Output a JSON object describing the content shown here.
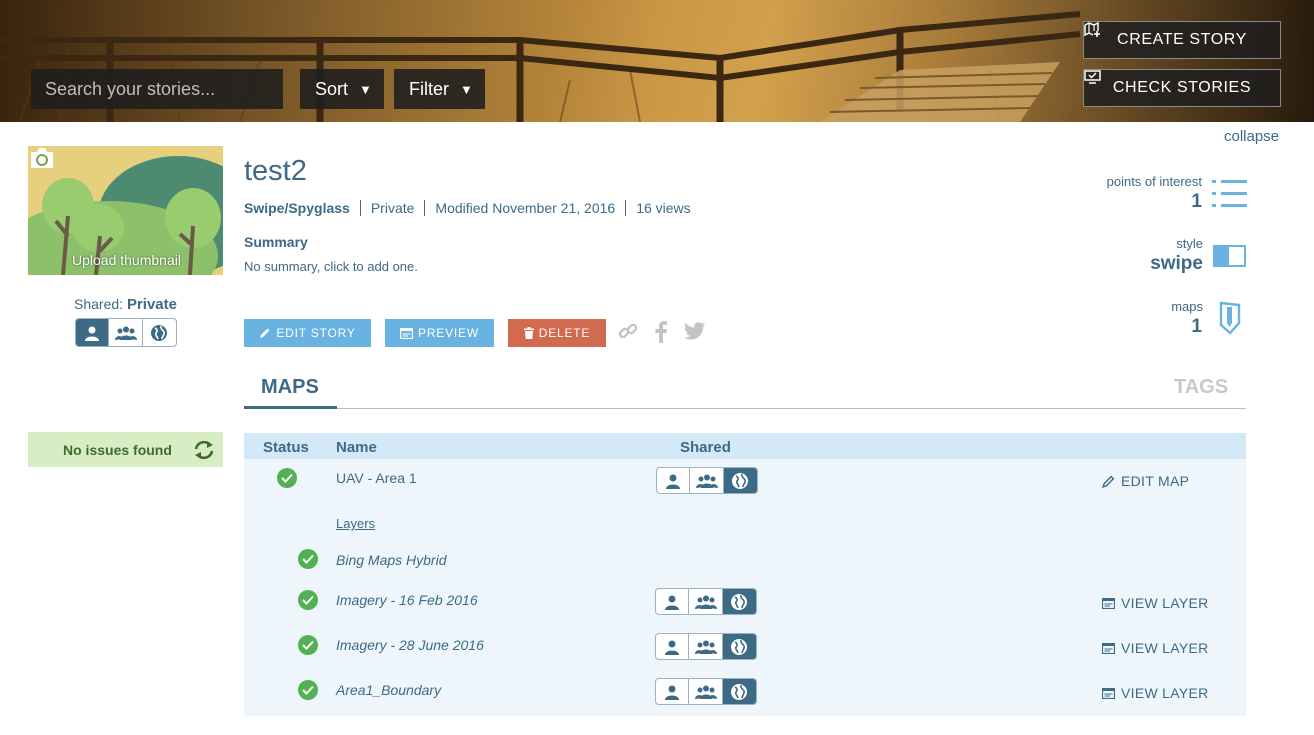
{
  "header": {
    "search_placeholder": "Search your stories...",
    "sort_label": "Sort",
    "filter_label": "Filter",
    "create_story_label": "CREATE STORY",
    "check_stories_label": "CHECK STORIES"
  },
  "collapse_label": "collapse",
  "thumbnail": {
    "caption": "Upload thumbnail"
  },
  "shared": {
    "label": "Shared:",
    "value": "Private"
  },
  "issues": {
    "label": "No issues found"
  },
  "story": {
    "title": "test2",
    "template": "Swipe/Spyglass",
    "privacy": "Private",
    "modified": "Modified November 21, 2016",
    "views": "16 views",
    "summary_heading": "Summary",
    "summary_text": "No summary, click to add one."
  },
  "actions": {
    "edit_label": "EDIT STORY",
    "preview_label": "PREVIEW",
    "delete_label": "DELETE"
  },
  "stats": {
    "poi_label": "points of interest",
    "poi_value": "1",
    "style_label": "style",
    "style_value": "swipe",
    "maps_label": "maps",
    "maps_value": "1"
  },
  "tabs": {
    "maps": "MAPS",
    "tags": "TAGS"
  },
  "table": {
    "col_status": "Status",
    "col_name": "Name",
    "col_shared": "Shared",
    "map": {
      "name": "UAV - Area 1",
      "action": "EDIT MAP"
    },
    "layers_label": "Layers",
    "layers": [
      {
        "name": "Bing Maps Hybrid"
      },
      {
        "name": "Imagery - 16 Feb 2016",
        "action": "VIEW LAYER"
      },
      {
        "name": "Imagery - 28 June 2016",
        "action": "VIEW LAYER"
      },
      {
        "name": "Area1_Boundary",
        "action": "VIEW LAYER"
      }
    ]
  },
  "colors": {
    "primary_text": "#3d6a85",
    "accent_blue": "#69b3e2",
    "delete_red": "#d16a4e",
    "success_green": "#54b054",
    "issues_bg": "#d9edc4",
    "table_header_bg": "#d3e9f8",
    "table_bg": "#eef6fc"
  }
}
